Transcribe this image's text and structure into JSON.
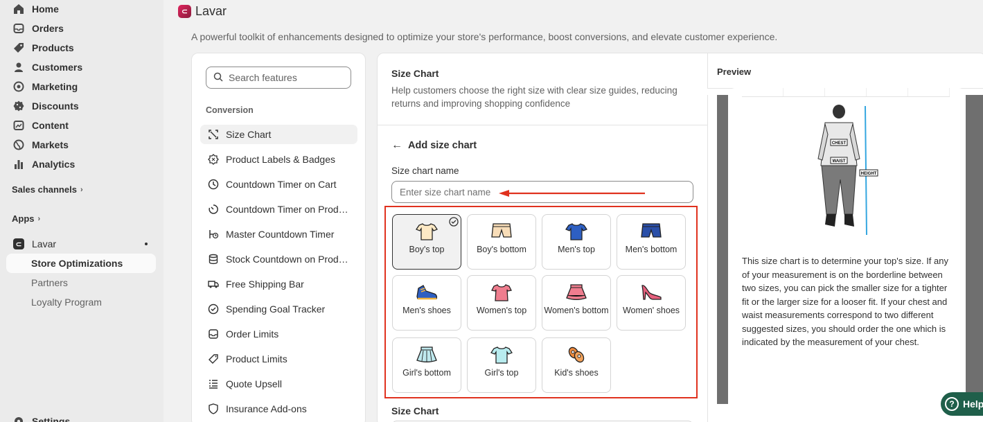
{
  "sidebar": {
    "items": [
      {
        "label": "Home",
        "icon": "home-icon"
      },
      {
        "label": "Orders",
        "icon": "orders-icon"
      },
      {
        "label": "Products",
        "icon": "products-icon"
      },
      {
        "label": "Customers",
        "icon": "customers-icon"
      },
      {
        "label": "Marketing",
        "icon": "marketing-icon"
      },
      {
        "label": "Discounts",
        "icon": "discounts-icon"
      },
      {
        "label": "Content",
        "icon": "content-icon"
      },
      {
        "label": "Markets",
        "icon": "markets-icon"
      },
      {
        "label": "Analytics",
        "icon": "analytics-icon"
      }
    ],
    "sales_channels": "Sales channels",
    "apps": "Apps",
    "app_name": "Lavar",
    "sub_items": [
      "Store Optimizations",
      "Partners",
      "Loyalty Program"
    ],
    "settings": "Settings"
  },
  "header": {
    "title": "Lavar",
    "subtitle": "A powerful toolkit of enhancements designed to optimize your store's performance, boost conversions, and elevate customer experience."
  },
  "features": {
    "search_placeholder": "Search features",
    "group": "Conversion",
    "items": [
      "Size Chart",
      "Product Labels & Badges",
      "Countdown Timer on Cart",
      "Countdown Timer on Product Page",
      "Master Countdown Timer",
      "Stock Countdown on Product Page",
      "Free Shipping Bar",
      "Spending Goal Tracker",
      "Order Limits",
      "Product Limits",
      "Quote Upsell",
      "Insurance Add-ons"
    ],
    "active": "Size Chart"
  },
  "main": {
    "title": "Size Chart",
    "description": "Help customers choose the right size with clear size guides, reducing returns and improving shopping confidence",
    "back_label": "Add size chart",
    "name_label": "Size chart name",
    "name_placeholder": "Enter size chart name",
    "templates": [
      "Boy's top",
      "Boy's bottom",
      "Men's top",
      "Men's bottom",
      "Men's shoes",
      "Women's top",
      "Women's bottom",
      "Women' shoes",
      "Girl's bottom",
      "Girl's top",
      "Kid's shoes"
    ],
    "selected_template": "Boy's top",
    "bottom_title": "Size Chart"
  },
  "preview": {
    "label": "Preview",
    "figure_labels": {
      "chest": "CHEST",
      "waist": "WAIST",
      "height": "HEIGHT"
    },
    "text": "This size chart is to determine your top's size. If any of your measurement is on the borderline between two sizes, you can pick the smaller size for a tighter fit or the larger size for a looser fit. If your chest and waist measurements correspond to two different suggested sizes, you should order the one which is indicated by the measurement of your chest."
  },
  "help": {
    "label": "Help"
  },
  "colors": {
    "highlight": "#e0311e",
    "help": "#1f5f4a"
  }
}
